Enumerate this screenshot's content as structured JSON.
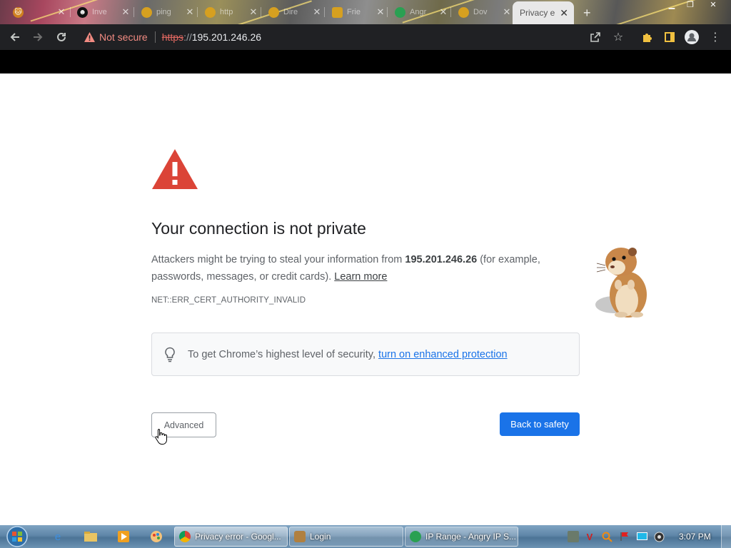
{
  "browser": {
    "tabs": [
      {
        "label": "",
        "icon": "cat-icon",
        "color": "#d08020"
      },
      {
        "label": "Inve",
        "icon": "tux-icon",
        "color": "#111111"
      },
      {
        "label": "ping",
        "icon": "folder-icon",
        "color": "#d6a020"
      },
      {
        "label": "http",
        "icon": "folder-icon",
        "color": "#d6a020"
      },
      {
        "label": "Dire",
        "icon": "folder-icon",
        "color": "#d6a020"
      },
      {
        "label": "Frie",
        "icon": "site-icon",
        "color": "#d6a020"
      },
      {
        "label": "Angr",
        "icon": "angry-ip-icon",
        "color": "#2aa052"
      },
      {
        "label": "Dov",
        "icon": "folder-icon",
        "color": "#d6a020"
      }
    ],
    "active_tab": {
      "label": "Privacy e",
      "close": "✕"
    },
    "new_tab": "+",
    "omnibox": {
      "security_label": "Not secure",
      "scheme": "https",
      "separator": "://",
      "host": "195.201.246.26"
    }
  },
  "page": {
    "headline": "Your connection is not private",
    "body_prefix": "Attackers might be trying to steal your information from ",
    "body_host": "195.201.246.26",
    "body_suffix": " (for example, passwords, messages, or credit cards). ",
    "learn_more": "Learn more",
    "error_code": "NET::ERR_CERT_AUTHORITY_INVALID",
    "enhanced_prefix": "To get Chrome’s highest level of security, ",
    "enhanced_link": "turn on enhanced protection",
    "advanced_label": "Advanced",
    "back_label": "Back to safety"
  },
  "taskbar": {
    "tasks": [
      {
        "label": "Privacy error - Googl...",
        "icon_color": "#db4437",
        "active": true
      },
      {
        "label": "Login",
        "icon_color": "#b08040",
        "active": false
      },
      {
        "label": "IP Range - Angry IP S...",
        "icon_color": "#2aa052",
        "active": false
      }
    ],
    "clock": "3:07 PM"
  },
  "colors": {
    "accent": "#1a73e8",
    "warning": "#db4437",
    "not_secure": "#f28b82"
  }
}
